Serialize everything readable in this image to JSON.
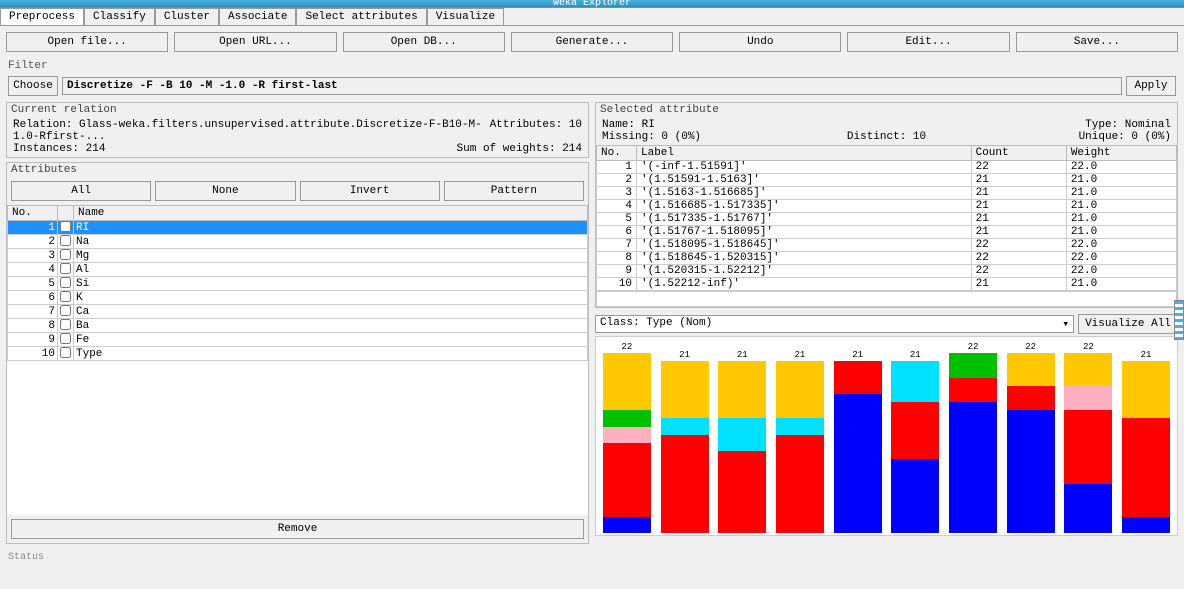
{
  "window_title": "Weka Explorer",
  "tabs": [
    "Preprocess",
    "Classify",
    "Cluster",
    "Associate",
    "Select attributes",
    "Visualize"
  ],
  "active_tab": 0,
  "top_buttons": [
    "Open file...",
    "Open URL...",
    "Open DB...",
    "Generate...",
    "Undo",
    "Edit...",
    "Save..."
  ],
  "filter": {
    "label": "Filter",
    "choose": "Choose",
    "value": "Discretize -F -B 10 -M -1.0 -R first-last",
    "apply": "Apply"
  },
  "current_relation": {
    "title": "Current relation",
    "relation_label": "Relation:",
    "relation": "Glass-weka.filters.unsupervised.attribute.Discretize-F-B10-M-1.0-Rfirst-...",
    "attributes_label": "Attributes:",
    "attributes": "10",
    "instances_label": "Instances:",
    "instances": "214",
    "sow_label": "Sum of weights:",
    "sow": "214"
  },
  "attributes_panel": {
    "title": "Attributes",
    "buttons": [
      "All",
      "None",
      "Invert",
      "Pattern"
    ],
    "headers": [
      "No.",
      "",
      "Name"
    ],
    "rows": [
      {
        "no": 1,
        "name": "RI",
        "selected": true
      },
      {
        "no": 2,
        "name": "Na"
      },
      {
        "no": 3,
        "name": "Mg"
      },
      {
        "no": 4,
        "name": "Al"
      },
      {
        "no": 5,
        "name": "Si"
      },
      {
        "no": 6,
        "name": "K"
      },
      {
        "no": 7,
        "name": "Ca"
      },
      {
        "no": 8,
        "name": "Ba"
      },
      {
        "no": 9,
        "name": "Fe"
      },
      {
        "no": 10,
        "name": "Type"
      }
    ],
    "remove": "Remove"
  },
  "selected_attribute": {
    "title": "Selected attribute",
    "name_label": "Name:",
    "name": "RI",
    "type_label": "Type:",
    "type": "Nominal",
    "missing_label": "Missing:",
    "missing": "0 (0%)",
    "distinct_label": "Distinct:",
    "distinct": "10",
    "unique_label": "Unique:",
    "unique": "0 (0%)",
    "headers": [
      "No.",
      "Label",
      "Count",
      "Weight"
    ],
    "rows": [
      {
        "no": 1,
        "label": "'(-inf-1.51591]'",
        "count": 22,
        "weight": "22.0"
      },
      {
        "no": 2,
        "label": "'(1.51591-1.5163]'",
        "count": 21,
        "weight": "21.0"
      },
      {
        "no": 3,
        "label": "'(1.5163-1.516685]'",
        "count": 21,
        "weight": "21.0"
      },
      {
        "no": 4,
        "label": "'(1.516685-1.517335]'",
        "count": 21,
        "weight": "21.0"
      },
      {
        "no": 5,
        "label": "'(1.517335-1.51767]'",
        "count": 21,
        "weight": "21.0"
      },
      {
        "no": 6,
        "label": "'(1.51767-1.518095]'",
        "count": 21,
        "weight": "21.0"
      },
      {
        "no": 7,
        "label": "'(1.518095-1.518645]'",
        "count": 22,
        "weight": "22.0"
      },
      {
        "no": 8,
        "label": "'(1.518645-1.520315]'",
        "count": 22,
        "weight": "22.0"
      },
      {
        "no": 9,
        "label": "'(1.520315-1.52212]'",
        "count": 22,
        "weight": "22.0"
      },
      {
        "no": 10,
        "label": "'(1.52212-inf)'",
        "count": 21,
        "weight": "21.0"
      }
    ]
  },
  "class_selector": {
    "label": "Class: Type (Nom)",
    "visualize": "Visualize All"
  },
  "chart_data": {
    "type": "stacked-bar-histogram",
    "ylim": [
      0,
      22
    ],
    "colors": {
      "blue": "#0000ff",
      "red": "#ff0000",
      "cyan": "#00e0ff",
      "yellow": "#ffc800",
      "green": "#00c000",
      "pink": "#ffb0c0"
    },
    "bars": [
      {
        "total": 22,
        "segments": [
          {
            "c": "blue",
            "v": 2
          },
          {
            "c": "red",
            "v": 9
          },
          {
            "c": "pink",
            "v": 2
          },
          {
            "c": "green",
            "v": 2
          },
          {
            "c": "yellow",
            "v": 7
          }
        ]
      },
      {
        "total": 21,
        "segments": [
          {
            "c": "red",
            "v": 12
          },
          {
            "c": "cyan",
            "v": 2
          },
          {
            "c": "yellow",
            "v": 7
          }
        ]
      },
      {
        "total": 21,
        "segments": [
          {
            "c": "red",
            "v": 10
          },
          {
            "c": "cyan",
            "v": 4
          },
          {
            "c": "yellow",
            "v": 7
          }
        ]
      },
      {
        "total": 21,
        "segments": [
          {
            "c": "red",
            "v": 12
          },
          {
            "c": "cyan",
            "v": 2
          },
          {
            "c": "yellow",
            "v": 7
          }
        ]
      },
      {
        "total": 21,
        "segments": [
          {
            "c": "blue",
            "v": 17
          },
          {
            "c": "red",
            "v": 4
          }
        ]
      },
      {
        "total": 21,
        "segments": [
          {
            "c": "blue",
            "v": 9
          },
          {
            "c": "red",
            "v": 7
          },
          {
            "c": "cyan",
            "v": 5
          }
        ]
      },
      {
        "total": 22,
        "segments": [
          {
            "c": "blue",
            "v": 16
          },
          {
            "c": "red",
            "v": 3
          },
          {
            "c": "green",
            "v": 3
          }
        ]
      },
      {
        "total": 22,
        "segments": [
          {
            "c": "blue",
            "v": 15
          },
          {
            "c": "red",
            "v": 3
          },
          {
            "c": "yellow",
            "v": 4
          }
        ]
      },
      {
        "total": 22,
        "segments": [
          {
            "c": "blue",
            "v": 6
          },
          {
            "c": "red",
            "v": 9
          },
          {
            "c": "pink",
            "v": 3
          },
          {
            "c": "yellow",
            "v": 4
          }
        ]
      },
      {
        "total": 21,
        "segments": [
          {
            "c": "blue",
            "v": 2
          },
          {
            "c": "red",
            "v": 12
          },
          {
            "c": "yellow",
            "v": 7
          }
        ]
      }
    ]
  },
  "status": "Status"
}
